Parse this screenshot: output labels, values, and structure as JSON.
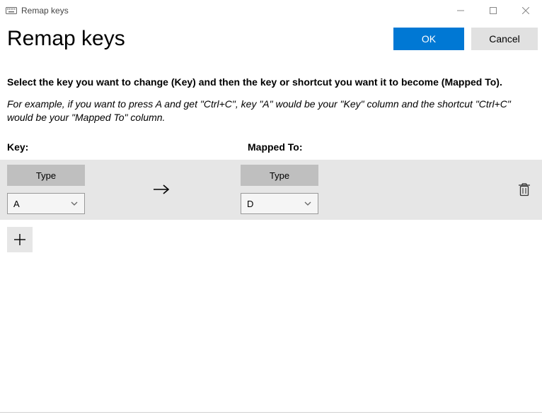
{
  "window": {
    "title": "Remap keys"
  },
  "header": {
    "title": "Remap keys",
    "ok_label": "OK",
    "cancel_label": "Cancel"
  },
  "description": {
    "line1": "Select the key you want to change (Key) and then the key or shortcut you want it to become (Mapped To).",
    "line2": "For example, if you want to press A and get \"Ctrl+C\", key \"A\" would be your \"Key\" column and the shortcut \"Ctrl+C\" would be your \"Mapped To\" column."
  },
  "labels": {
    "key": "Key:",
    "mapped": "Mapped To:"
  },
  "row": {
    "key_type_label": "Type",
    "key_select_value": "A",
    "mapped_type_label": "Type",
    "mapped_select_value": "D"
  }
}
